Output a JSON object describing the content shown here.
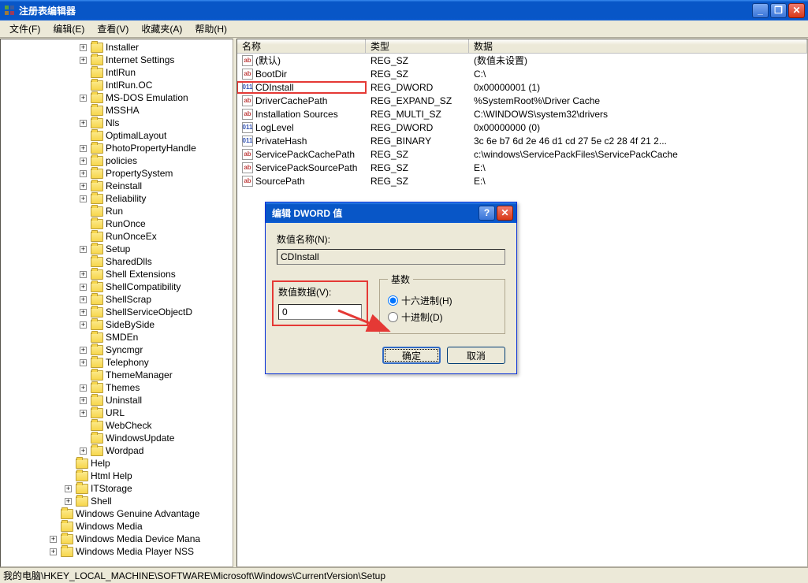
{
  "window": {
    "title": "注册表编辑器"
  },
  "menu": {
    "file": "文件(F)",
    "edit": "编辑(E)",
    "view": "查看(V)",
    "favorites": "收藏夹(A)",
    "help": "帮助(H)"
  },
  "tree": {
    "items": [
      {
        "indent": 6,
        "expander": "+",
        "label": "Installer"
      },
      {
        "indent": 6,
        "expander": "+",
        "label": "Internet Settings"
      },
      {
        "indent": 6,
        "expander": "",
        "label": "IntlRun"
      },
      {
        "indent": 6,
        "expander": "",
        "label": "IntlRun.OC"
      },
      {
        "indent": 6,
        "expander": "+",
        "label": "MS-DOS Emulation"
      },
      {
        "indent": 6,
        "expander": "",
        "label": "MSSHA"
      },
      {
        "indent": 6,
        "expander": "+",
        "label": "Nls"
      },
      {
        "indent": 6,
        "expander": "",
        "label": "OptimalLayout"
      },
      {
        "indent": 6,
        "expander": "+",
        "label": "PhotoPropertyHandle"
      },
      {
        "indent": 6,
        "expander": "+",
        "label": "policies"
      },
      {
        "indent": 6,
        "expander": "+",
        "label": "PropertySystem"
      },
      {
        "indent": 6,
        "expander": "+",
        "label": "Reinstall"
      },
      {
        "indent": 6,
        "expander": "+",
        "label": "Reliability"
      },
      {
        "indent": 6,
        "expander": "",
        "label": "Run"
      },
      {
        "indent": 6,
        "expander": "",
        "label": "RunOnce"
      },
      {
        "indent": 6,
        "expander": "",
        "label": "RunOnceEx"
      },
      {
        "indent": 6,
        "expander": "+",
        "label": "Setup"
      },
      {
        "indent": 6,
        "expander": "",
        "label": "SharedDlls"
      },
      {
        "indent": 6,
        "expander": "+",
        "label": "Shell Extensions"
      },
      {
        "indent": 6,
        "expander": "+",
        "label": "ShellCompatibility"
      },
      {
        "indent": 6,
        "expander": "+",
        "label": "ShellScrap"
      },
      {
        "indent": 6,
        "expander": "+",
        "label": "ShellServiceObjectD"
      },
      {
        "indent": 6,
        "expander": "+",
        "label": "SideBySide"
      },
      {
        "indent": 6,
        "expander": "",
        "label": "SMDEn"
      },
      {
        "indent": 6,
        "expander": "+",
        "label": "Syncmgr"
      },
      {
        "indent": 6,
        "expander": "+",
        "label": "Telephony"
      },
      {
        "indent": 6,
        "expander": "",
        "label": "ThemeManager"
      },
      {
        "indent": 6,
        "expander": "+",
        "label": "Themes"
      },
      {
        "indent": 6,
        "expander": "+",
        "label": "Uninstall"
      },
      {
        "indent": 6,
        "expander": "+",
        "label": "URL"
      },
      {
        "indent": 6,
        "expander": "",
        "label": "WebCheck"
      },
      {
        "indent": 6,
        "expander": "",
        "label": "WindowsUpdate"
      },
      {
        "indent": 6,
        "expander": "+",
        "label": "Wordpad"
      },
      {
        "indent": 5,
        "expander": "",
        "label": "Help"
      },
      {
        "indent": 5,
        "expander": "",
        "label": "Html Help"
      },
      {
        "indent": 5,
        "expander": "+",
        "label": "ITStorage"
      },
      {
        "indent": 5,
        "expander": "+",
        "label": "Shell"
      },
      {
        "indent": 4,
        "expander": "",
        "label": "Windows Genuine Advantage"
      },
      {
        "indent": 4,
        "expander": "",
        "label": "Windows Media"
      },
      {
        "indent": 4,
        "expander": "+",
        "label": "Windows Media Device Mana"
      },
      {
        "indent": 4,
        "expander": "+",
        "label": "Windows Media Player NSS"
      }
    ]
  },
  "list": {
    "headers": {
      "name": "名称",
      "type": "类型",
      "data": "数据"
    },
    "rows": [
      {
        "icon": "str",
        "name": "(默认)",
        "type": "REG_SZ",
        "data": "(数值未设置)"
      },
      {
        "icon": "str",
        "name": "BootDir",
        "type": "REG_SZ",
        "data": "C:\\"
      },
      {
        "icon": "bin",
        "name": "CDInstall",
        "type": "REG_DWORD",
        "data": "0x00000001 (1)",
        "highlight": true
      },
      {
        "icon": "str",
        "name": "DriverCachePath",
        "type": "REG_EXPAND_SZ",
        "data": "%SystemRoot%\\Driver Cache"
      },
      {
        "icon": "str",
        "name": "Installation Sources",
        "type": "REG_MULTI_SZ",
        "data": "C:\\WINDOWS\\system32\\drivers"
      },
      {
        "icon": "bin",
        "name": "LogLevel",
        "type": "REG_DWORD",
        "data": "0x00000000 (0)"
      },
      {
        "icon": "bin",
        "name": "PrivateHash",
        "type": "REG_BINARY",
        "data": "3c 6e b7 6d 2e 46 d1 cd 27 5e c2 28 4f 21 2..."
      },
      {
        "icon": "str",
        "name": "ServicePackCachePath",
        "type": "REG_SZ",
        "data": "c:\\windows\\ServicePackFiles\\ServicePackCache"
      },
      {
        "icon": "str",
        "name": "ServicePackSourcePath",
        "type": "REG_SZ",
        "data": "E:\\"
      },
      {
        "icon": "str",
        "name": "SourcePath",
        "type": "REG_SZ",
        "data": "E:\\"
      }
    ]
  },
  "statusbar": {
    "path": "我的电脑\\HKEY_LOCAL_MACHINE\\SOFTWARE\\Microsoft\\Windows\\CurrentVersion\\Setup"
  },
  "dialog": {
    "title": "编辑 DWORD 值",
    "value_name_label": "数值名称(N):",
    "value_name": "CDInstall",
    "value_data_label": "数值数据(V):",
    "value_data": "0",
    "base_legend": "基数",
    "hex_label": "十六进制(H)",
    "dec_label": "十进制(D)",
    "ok": "确定",
    "cancel": "取消"
  }
}
